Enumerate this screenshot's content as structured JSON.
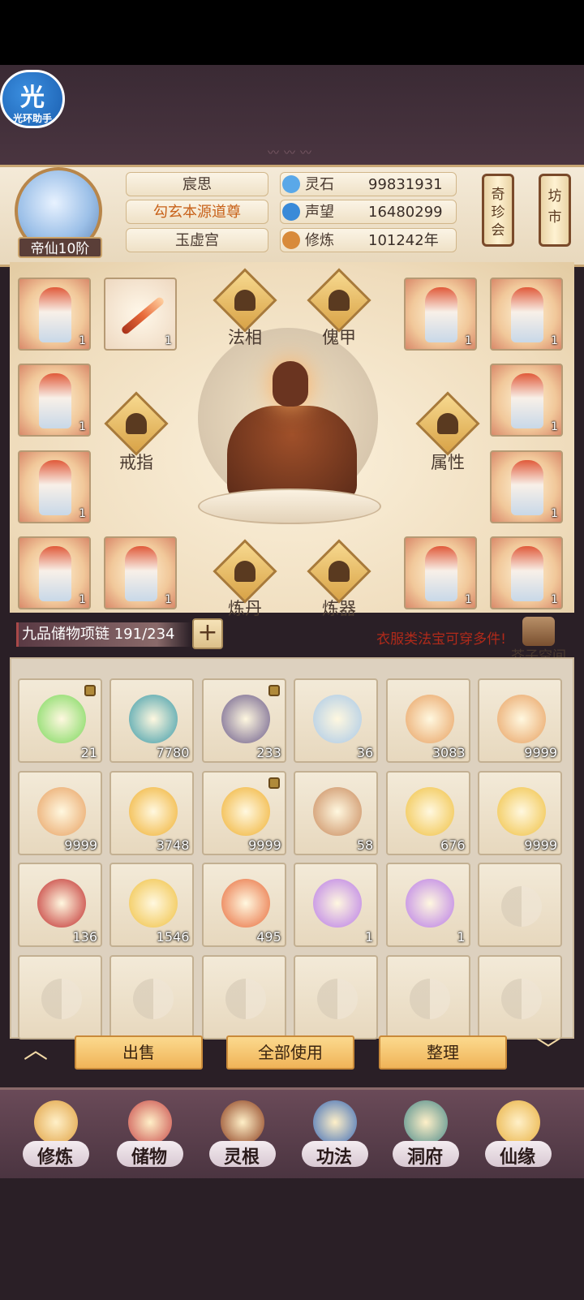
{
  "helper": {
    "glyph": "光",
    "label": "光环助手"
  },
  "player": {
    "name": "宸思",
    "title": "勾玄本源道尊",
    "sect": "玉虚宫",
    "rank": "帝仙10阶"
  },
  "resources": [
    {
      "label": "灵石",
      "value": "99831931",
      "icon": "spirit-stone-icon",
      "color": "#5aa8e8"
    },
    {
      "label": "声望",
      "value": "16480299",
      "icon": "prestige-icon",
      "color": "#3a8ad8"
    },
    {
      "label": "修炼",
      "value": "101242年",
      "icon": "meditation-icon",
      "color": "#d88a3a"
    }
  ],
  "shops": [
    {
      "label": "奇珍会"
    },
    {
      "label": "坊市"
    }
  ],
  "equipment": {
    "slots": [
      {
        "count": "1"
      },
      {
        "count": "1"
      },
      {
        "count": "1"
      },
      {
        "count": "1"
      },
      {
        "count": "1"
      },
      {
        "count": "1"
      },
      {
        "count": "1"
      },
      {
        "count": "1"
      },
      {
        "count": "1"
      },
      {
        "count": "1"
      },
      {
        "count": "1"
      },
      {
        "count": "1"
      }
    ],
    "categories": [
      "法相",
      "傀甲",
      "戒指",
      "属性",
      "炼丹",
      "炼器"
    ]
  },
  "bag": {
    "name": "九品储物项链 191/234",
    "plus": "+",
    "notice": "衣服类法宝可穿多件!",
    "space_label": "芥子空间"
  },
  "inventory": [
    {
      "count": "21",
      "locked": true,
      "color": "#7ad85a"
    },
    {
      "count": "7780",
      "locked": false,
      "color": "#3a9aa8"
    },
    {
      "count": "233",
      "locked": true,
      "color": "#6a5a8a"
    },
    {
      "count": "36",
      "locked": false,
      "color": "#a8c8e8"
    },
    {
      "count": "3083",
      "locked": false,
      "color": "#e8a060"
    },
    {
      "count": "9999",
      "locked": false,
      "color": "#e8a060"
    },
    {
      "count": "9999",
      "locked": false,
      "color": "#e8a060"
    },
    {
      "count": "3748",
      "locked": false,
      "color": "#f0b030"
    },
    {
      "count": "9999",
      "locked": true,
      "color": "#f0b030"
    },
    {
      "count": "58",
      "locked": false,
      "color": "#c8885a"
    },
    {
      "count": "676",
      "locked": false,
      "color": "#f0c040"
    },
    {
      "count": "9999",
      "locked": false,
      "color": "#f0c040"
    },
    {
      "count": "136",
      "locked": false,
      "color": "#c02a2a"
    },
    {
      "count": "1546",
      "locked": false,
      "color": "#f0c040"
    },
    {
      "count": "495",
      "locked": false,
      "color": "#e86a3a"
    },
    {
      "count": "1",
      "locked": false,
      "color": "#b87ae8"
    },
    {
      "count": "1",
      "locked": false,
      "color": "#b87ae8"
    }
  ],
  "actions": {
    "sell": "出售",
    "use_all": "全部使用",
    "sort": "整理"
  },
  "nav": [
    {
      "label": "修炼",
      "color": "#e0a040"
    },
    {
      "label": "储物",
      "color": "#c84848"
    },
    {
      "label": "灵根",
      "color": "#8a3a1a"
    },
    {
      "label": "功法",
      "color": "#3a6ab8"
    },
    {
      "label": "洞府",
      "color": "#4a8a8a"
    },
    {
      "label": "仙缘",
      "color": "#e8b040"
    }
  ]
}
